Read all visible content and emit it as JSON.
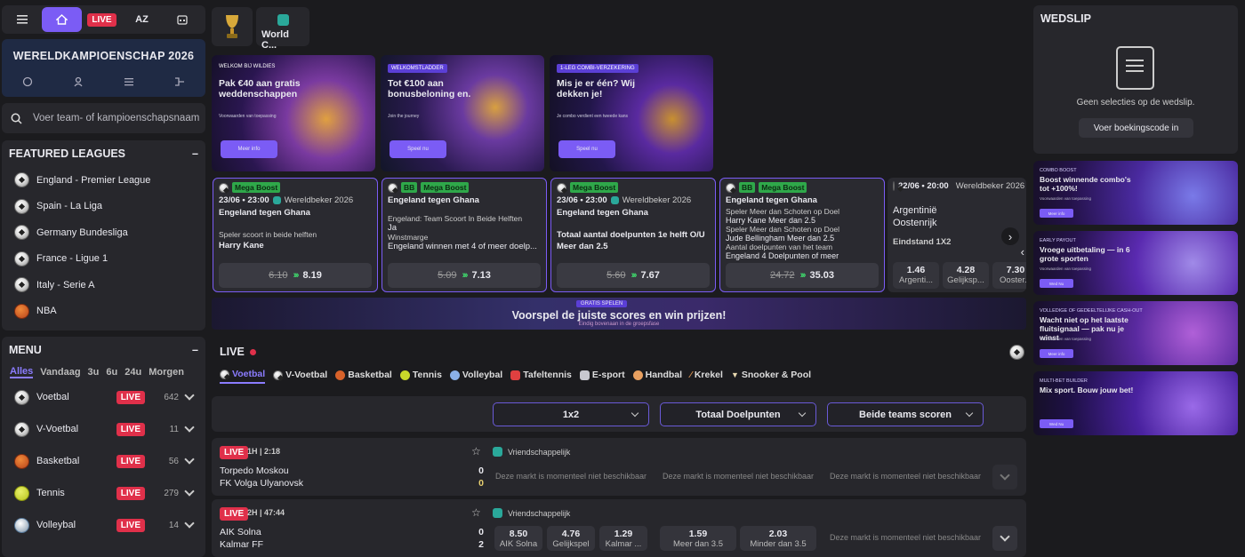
{
  "nav": {
    "live": "LIVE",
    "az": "AZ"
  },
  "wk": {
    "title": "WERELDKAMPIOENSCHAP 2026"
  },
  "search": {
    "placeholder": "Voer team- of kampioenschapsnaam in"
  },
  "featured": {
    "title": "FEATURED LEAGUES",
    "collapse": "–",
    "items": [
      {
        "label": "England - Premier League",
        "icon": "soccer-ball-icon"
      },
      {
        "label": "Spain - La Liga",
        "icon": "soccer-ball-icon"
      },
      {
        "label": "Germany Bundesliga",
        "icon": "soccer-ball-icon"
      },
      {
        "label": "France - Ligue 1",
        "icon": "soccer-ball-icon"
      },
      {
        "label": "Italy - Serie A",
        "icon": "soccer-ball-icon"
      },
      {
        "label": "NBA",
        "icon": "basketball-icon"
      }
    ]
  },
  "menu": {
    "title": "MENU",
    "collapse": "–",
    "filters": [
      "Alles",
      "Vandaag",
      "3u",
      "6u",
      "24u",
      "Morgen"
    ],
    "live": "LIVE",
    "sports": [
      {
        "label": "Voetbal",
        "count": "642"
      },
      {
        "label": "V-Voetbal",
        "count": "11"
      },
      {
        "label": "Basketbal",
        "count": "56"
      },
      {
        "label": "Tennis",
        "count": "279"
      },
      {
        "label": "Volleybal",
        "count": "14"
      }
    ]
  },
  "wc_tab": "World C...",
  "promos": [
    {
      "tag": "WELKOM BIJ WILDIES",
      "title": "Pak €40 aan gratis weddenschappen",
      "sub": "Voorwaarden van toepassing",
      "button": "Meer info"
    },
    {
      "tag": "WELKOMSTLADDER",
      "title": "Tot €100 aan bonusbeloning en.",
      "sub": "Join the journey",
      "button": "Speel nu"
    },
    {
      "tag": "1-LEG COMBI-VERZEKERING",
      "title": "Mis je er één? Wij dekken je!",
      "sub": "Je combo verdient een tweede kans",
      "button": "Speel nu"
    }
  ],
  "cards": [
    {
      "badge": "Mega Boost",
      "bb": "",
      "date": "23/06 • 23:00",
      "comp": "Wereldbeker 2026",
      "match": "Engeland tegen Ghana",
      "line1": "Speler scoort in beide helften",
      "line2": "Harry Kane",
      "old": "6.10",
      "new": "8.19"
    },
    {
      "badge": "Mega Boost",
      "bb": "BB",
      "date": "",
      "comp": "",
      "match": "Engeland tegen Ghana",
      "line1": "Engeland: Team Scoort In Beide Helften",
      "line2": "Ja",
      "line3": "Winstmarge",
      "line4": "Engeland winnen met 4 of meer doelp...",
      "old": "5.09",
      "new": "7.13"
    },
    {
      "badge": "Mega Boost",
      "bb": "",
      "date": "23/06 • 23:00",
      "comp": "Wereldbeker 2026",
      "match": "Engeland tegen Ghana",
      "line1": "Totaal aantal doelpunten 1e helft O/U",
      "line2": "Meer dan 2.5",
      "old": "5.60",
      "new": "7.67"
    },
    {
      "badge": "Mega Boost",
      "bb": "BB",
      "date": "",
      "comp": "",
      "match": "Engeland tegen Ghana",
      "l1": "Speler Meer dan Schoten op Doel",
      "l2": "Harry Kane Meer dan 2.5",
      "l3": "Speler Meer dan Schoten op Doel",
      "l4": "Jude Bellingham Meer dan 2.5",
      "l5": "Aantal doelpunten van het team",
      "l6": "Engeland 4 Doelpunten of meer",
      "old": "24.72",
      "new": "35.03"
    }
  ],
  "card5": {
    "date": "22/06 • 20:00",
    "comp": "Wereldbeker 2026",
    "team1": "Argentinië",
    "team2": "Oostenrijk",
    "market": "Eindstand 1X2",
    "odds": [
      {
        "v": "1.46",
        "l": "Argenti..."
      },
      {
        "v": "4.28",
        "l": "Gelijksp..."
      },
      {
        "v": "7.30",
        "l": "Ooster..."
      }
    ]
  },
  "banner": {
    "pill": "GRATIS SPELEN",
    "title": "Voorspel de juiste scores en win prijzen!",
    "sub": "Eindig bovenaan in de groepsfase"
  },
  "live": {
    "title": "LIVE"
  },
  "sport_tabs": [
    "Voetbal",
    "V-Voetbal",
    "Basketbal",
    "Tennis",
    "Volleybal",
    "Tafeltennis",
    "E-sport",
    "Handbal",
    "Krekel",
    "Snooker & Pool"
  ],
  "markets": [
    "1x2",
    "Totaal Doelpunten",
    "Beide teams scoren"
  ],
  "matches": [
    {
      "live": "LIVE",
      "time": "1H | 2:18",
      "comp": "Vriendschappelijk",
      "team1": "Torpedo Moskou",
      "team2": "FK Volga Ulyanovsk",
      "score1": "0",
      "score2": "0",
      "na": "Deze markt is momenteel niet beschikbaar"
    },
    {
      "live": "LIVE",
      "time": "2H | 47:44",
      "comp": "Vriendschappelijk",
      "team1": "AIK Solna",
      "team2": "Kalmar FF",
      "score1": "0",
      "score2": "2",
      "odds1x2": [
        {
          "v": "8.50",
          "l": "AIK Solna"
        },
        {
          "v": "4.76",
          "l": "Gelijkspel"
        },
        {
          "v": "1.29",
          "l": "Kalmar ..."
        }
      ],
      "oddsTotal": [
        {
          "v": "1.59",
          "l": "Meer dan 3.5"
        },
        {
          "v": "2.03",
          "l": "Minder dan 3.5"
        }
      ],
      "na": "Deze markt is momenteel niet beschikbaar"
    }
  ],
  "slip": {
    "title": "WEDSLIP",
    "empty": "Geen selecties op de wedslip.",
    "booking": "Voer boekingscode in"
  },
  "right_promos": [
    {
      "tag": "COMBO BOOST",
      "title": "Boost winnende combo's tot +100%!",
      "sub": "Voorwaarden van toepassing",
      "button": "Meer info"
    },
    {
      "tag": "EARLY PAYOUT",
      "title": "Vroege uitbetaling — in 6 grote sporten",
      "sub": "Voorwaarden van toepassing",
      "button": "Wed Nu"
    },
    {
      "tag": "VOLLEDIGE OF GEDEELTELIJKE CASH-OUT",
      "title": "Wacht niet op het laatste fluitsignaal — pak nu je winst",
      "sub": "Voorwaarden van toepassing",
      "button": "Meer info"
    },
    {
      "tag": "MULTI-BET BUILDER",
      "title": "Mix sport. Bouw jouw bet!",
      "sub": "",
      "button": "Wed Nu"
    }
  ]
}
